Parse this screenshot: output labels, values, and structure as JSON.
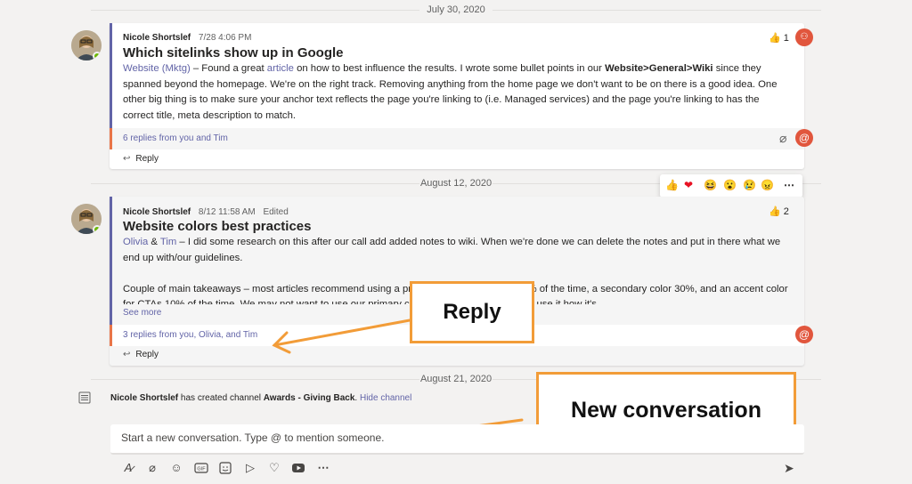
{
  "dates": [
    "July 30, 2020",
    "August 12, 2020",
    "August 21, 2020"
  ],
  "messages": [
    {
      "author": "Nicole Shortslef",
      "time": "7/28 4:06 PM",
      "edited": "",
      "title": "Which sitelinks show up in Google",
      "body": {
        "mention": "Website (Mktg)",
        "t1": " – Found a great ",
        "link": "article",
        "t2": " on how to best influence the results. I wrote some bullet points in our ",
        "bold": "Website>General>Wiki",
        "t3": " since they spanned beyond the homepage. We're on the right track. Removing anything from the home page we don't want to be on there is a good idea. One other big thing is to make sure your anchor text reflects the page you're linking to (i.e. Managed services) and the page you're linking to has the correct title, meta description to match."
      },
      "replies_summary": "6 replies from you and Tim",
      "reply_label": "Reply",
      "reaction": {
        "icon": "👍",
        "count": "1"
      }
    },
    {
      "author": "Nicole Shortslef",
      "time": "8/12 11:58 AM",
      "edited": "Edited",
      "title": "Website colors best practices",
      "body": {
        "mention1": "Olivia",
        "amp": " & ",
        "mention2": "Tim",
        "t1": " – I did some research on this after our call add added notes to wiki. When we're done we can delete the notes and put in there what we end up with/our guidelines.",
        "t2": "Couple of main takeaways – most articles recommend using a primary color (logo color) 60% of the time, a secondary color 30%, and an accent color for CTAs 10% of the time. We may not want to use our primary color because we don't really use it how it's"
      },
      "see_more": "See more",
      "replies_summary": "3 replies from you, Olivia, and Tim",
      "reply_label": "Reply",
      "reaction": {
        "icon": "👍",
        "count": "2"
      }
    }
  ],
  "reaction_bar": [
    "👍",
    "❤",
    "😆",
    "😮",
    "😢",
    "😠",
    "⋯"
  ],
  "system_message": {
    "author": "Nicole Shortslef",
    "t1": " has created channel ",
    "channel": "Awards - Giving Back",
    "t2": ". ",
    "action": "Hide channel"
  },
  "compose": {
    "placeholder": "Start a new conversation. Type @ to mention someone."
  },
  "callouts": {
    "reply": "Reply",
    "new_conversation": "New conversation"
  },
  "toolbar_icons": [
    "format-icon",
    "attach-icon",
    "emoji-icon",
    "gif-icon",
    "sticker-icon",
    "schedule-meeting-icon",
    "praise-icon",
    "stream-icon",
    "more-options-icon",
    "send-icon"
  ],
  "colors": {
    "accent": "#6264a7",
    "mention": "#e1563d",
    "reply_bar": "#e97548",
    "callout_border": "#f29c38"
  }
}
